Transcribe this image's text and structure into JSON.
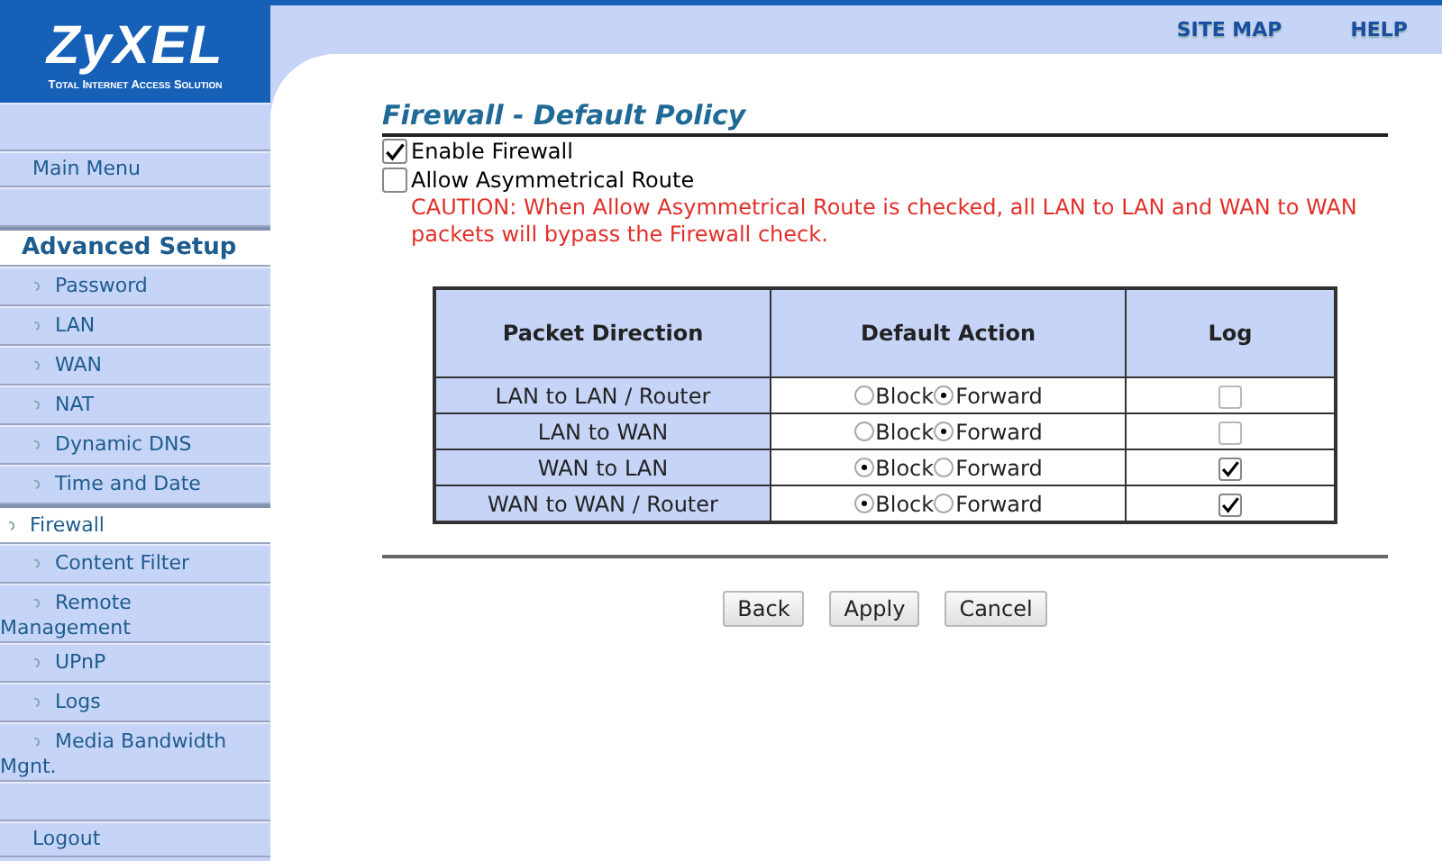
{
  "logo": {
    "name": "ZyXEL",
    "tagline": "Total Internet Access Solution"
  },
  "top_links": [
    "SITE MAP",
    "HELP"
  ],
  "sidebar": {
    "items": [
      {
        "kind": "gap"
      },
      {
        "kind": "menu",
        "label": "Main Menu"
      },
      {
        "kind": "gap"
      },
      {
        "kind": "heading",
        "label": "Advanced Setup"
      },
      {
        "kind": "item",
        "label": "Password",
        "selected": false
      },
      {
        "kind": "item",
        "label": "LAN",
        "selected": false
      },
      {
        "kind": "item",
        "label": "WAN",
        "selected": false
      },
      {
        "kind": "item",
        "label": "NAT",
        "selected": false
      },
      {
        "kind": "item",
        "label": "Dynamic DNS",
        "selected": false
      },
      {
        "kind": "item",
        "label": "Time and Date",
        "selected": false
      },
      {
        "kind": "item",
        "label": "Firewall",
        "selected": true
      },
      {
        "kind": "item",
        "label": "Content Filter",
        "selected": false
      },
      {
        "kind": "item",
        "label": "Remote Management",
        "selected": false
      },
      {
        "kind": "item",
        "label": "UPnP",
        "selected": false
      },
      {
        "kind": "item",
        "label": "Logs",
        "selected": false
      },
      {
        "kind": "item",
        "label": "Media Bandwidth Mgnt.",
        "selected": false
      },
      {
        "kind": "gap"
      },
      {
        "kind": "menu",
        "label": "Logout"
      }
    ]
  },
  "page": {
    "title": "Firewall - Default Policy",
    "options": [
      {
        "label": "Enable Firewall",
        "checked": true
      },
      {
        "label": "Allow Asymmetrical Route",
        "checked": false
      }
    ],
    "caution": "CAUTION: When Allow Asymmetrical Route is checked, all LAN to LAN and WAN to WAN packets will bypass the Firewall check.",
    "table": {
      "columns": [
        "Packet Direction",
        "Default Action",
        "Log"
      ],
      "rows": [
        {
          "direction": "LAN to LAN / Router",
          "actions": [
            {
              "label": "Block",
              "selected": false
            },
            {
              "label": "Forward",
              "selected": true
            }
          ],
          "log": false
        },
        {
          "direction": "LAN to WAN",
          "actions": [
            {
              "label": "Block",
              "selected": false
            },
            {
              "label": "Forward",
              "selected": true
            }
          ],
          "log": false
        },
        {
          "direction": "WAN to LAN",
          "actions": [
            {
              "label": "Block",
              "selected": true
            },
            {
              "label": "Forward",
              "selected": false
            }
          ],
          "log": true
        },
        {
          "direction": "WAN to WAN / Router",
          "actions": [
            {
              "label": "Block",
              "selected": true
            },
            {
              "label": "Forward",
              "selected": false
            }
          ],
          "log": true
        }
      ]
    },
    "buttons": [
      "Back",
      "Apply",
      "Cancel"
    ]
  }
}
